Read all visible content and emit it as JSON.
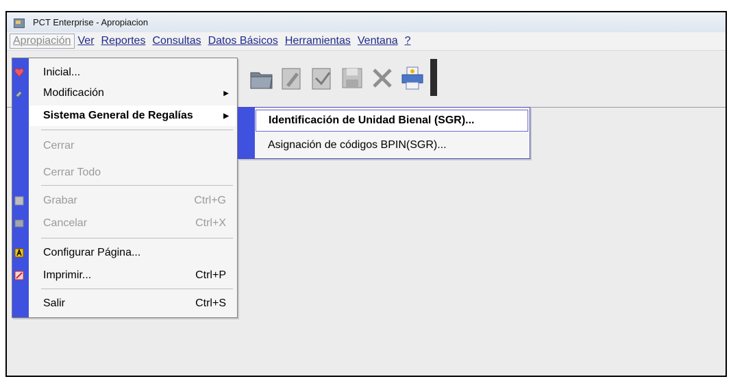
{
  "window": {
    "title": "PCT Enterprise - Apropiacion"
  },
  "menubar": {
    "items": [
      {
        "label": "Apropiación"
      },
      {
        "label": "Ver"
      },
      {
        "label": "Reportes"
      },
      {
        "label": "Consultas"
      },
      {
        "label": "Datos Básicos"
      },
      {
        "label": "Herramientas"
      },
      {
        "label": "Ventana"
      },
      {
        "label": "?"
      }
    ]
  },
  "toolbar": {
    "icons": [
      "open-folder-icon",
      "edit-document-icon",
      "check-document-icon",
      "save-disk-icon",
      "delete-x-icon",
      "printer-icon"
    ]
  },
  "dropdown": {
    "items": [
      {
        "label": "Inicial...",
        "shortcut": ""
      },
      {
        "label": "Modificación",
        "shortcut": ""
      },
      {
        "label": "Sistema General de Regalías",
        "shortcut": ""
      },
      {
        "label": "Cerrar",
        "shortcut": ""
      },
      {
        "label": "Cerrar Todo",
        "shortcut": ""
      },
      {
        "label": "Grabar",
        "shortcut": "Ctrl+G"
      },
      {
        "label": "Cancelar",
        "shortcut": "Ctrl+X"
      },
      {
        "label": "Configurar Página...",
        "shortcut": ""
      },
      {
        "label": "Imprimir...",
        "shortcut": "Ctrl+P"
      },
      {
        "label": "Salir",
        "shortcut": "Ctrl+S"
      }
    ]
  },
  "submenu": {
    "items": [
      {
        "label": "Identificación de Unidad Bienal (SGR)..."
      },
      {
        "label": "Asignación de códigos BPIN(SGR)..."
      }
    ]
  },
  "colors": {
    "accent_strip": "#3f52df",
    "menu_link": "#1f2a8a"
  }
}
